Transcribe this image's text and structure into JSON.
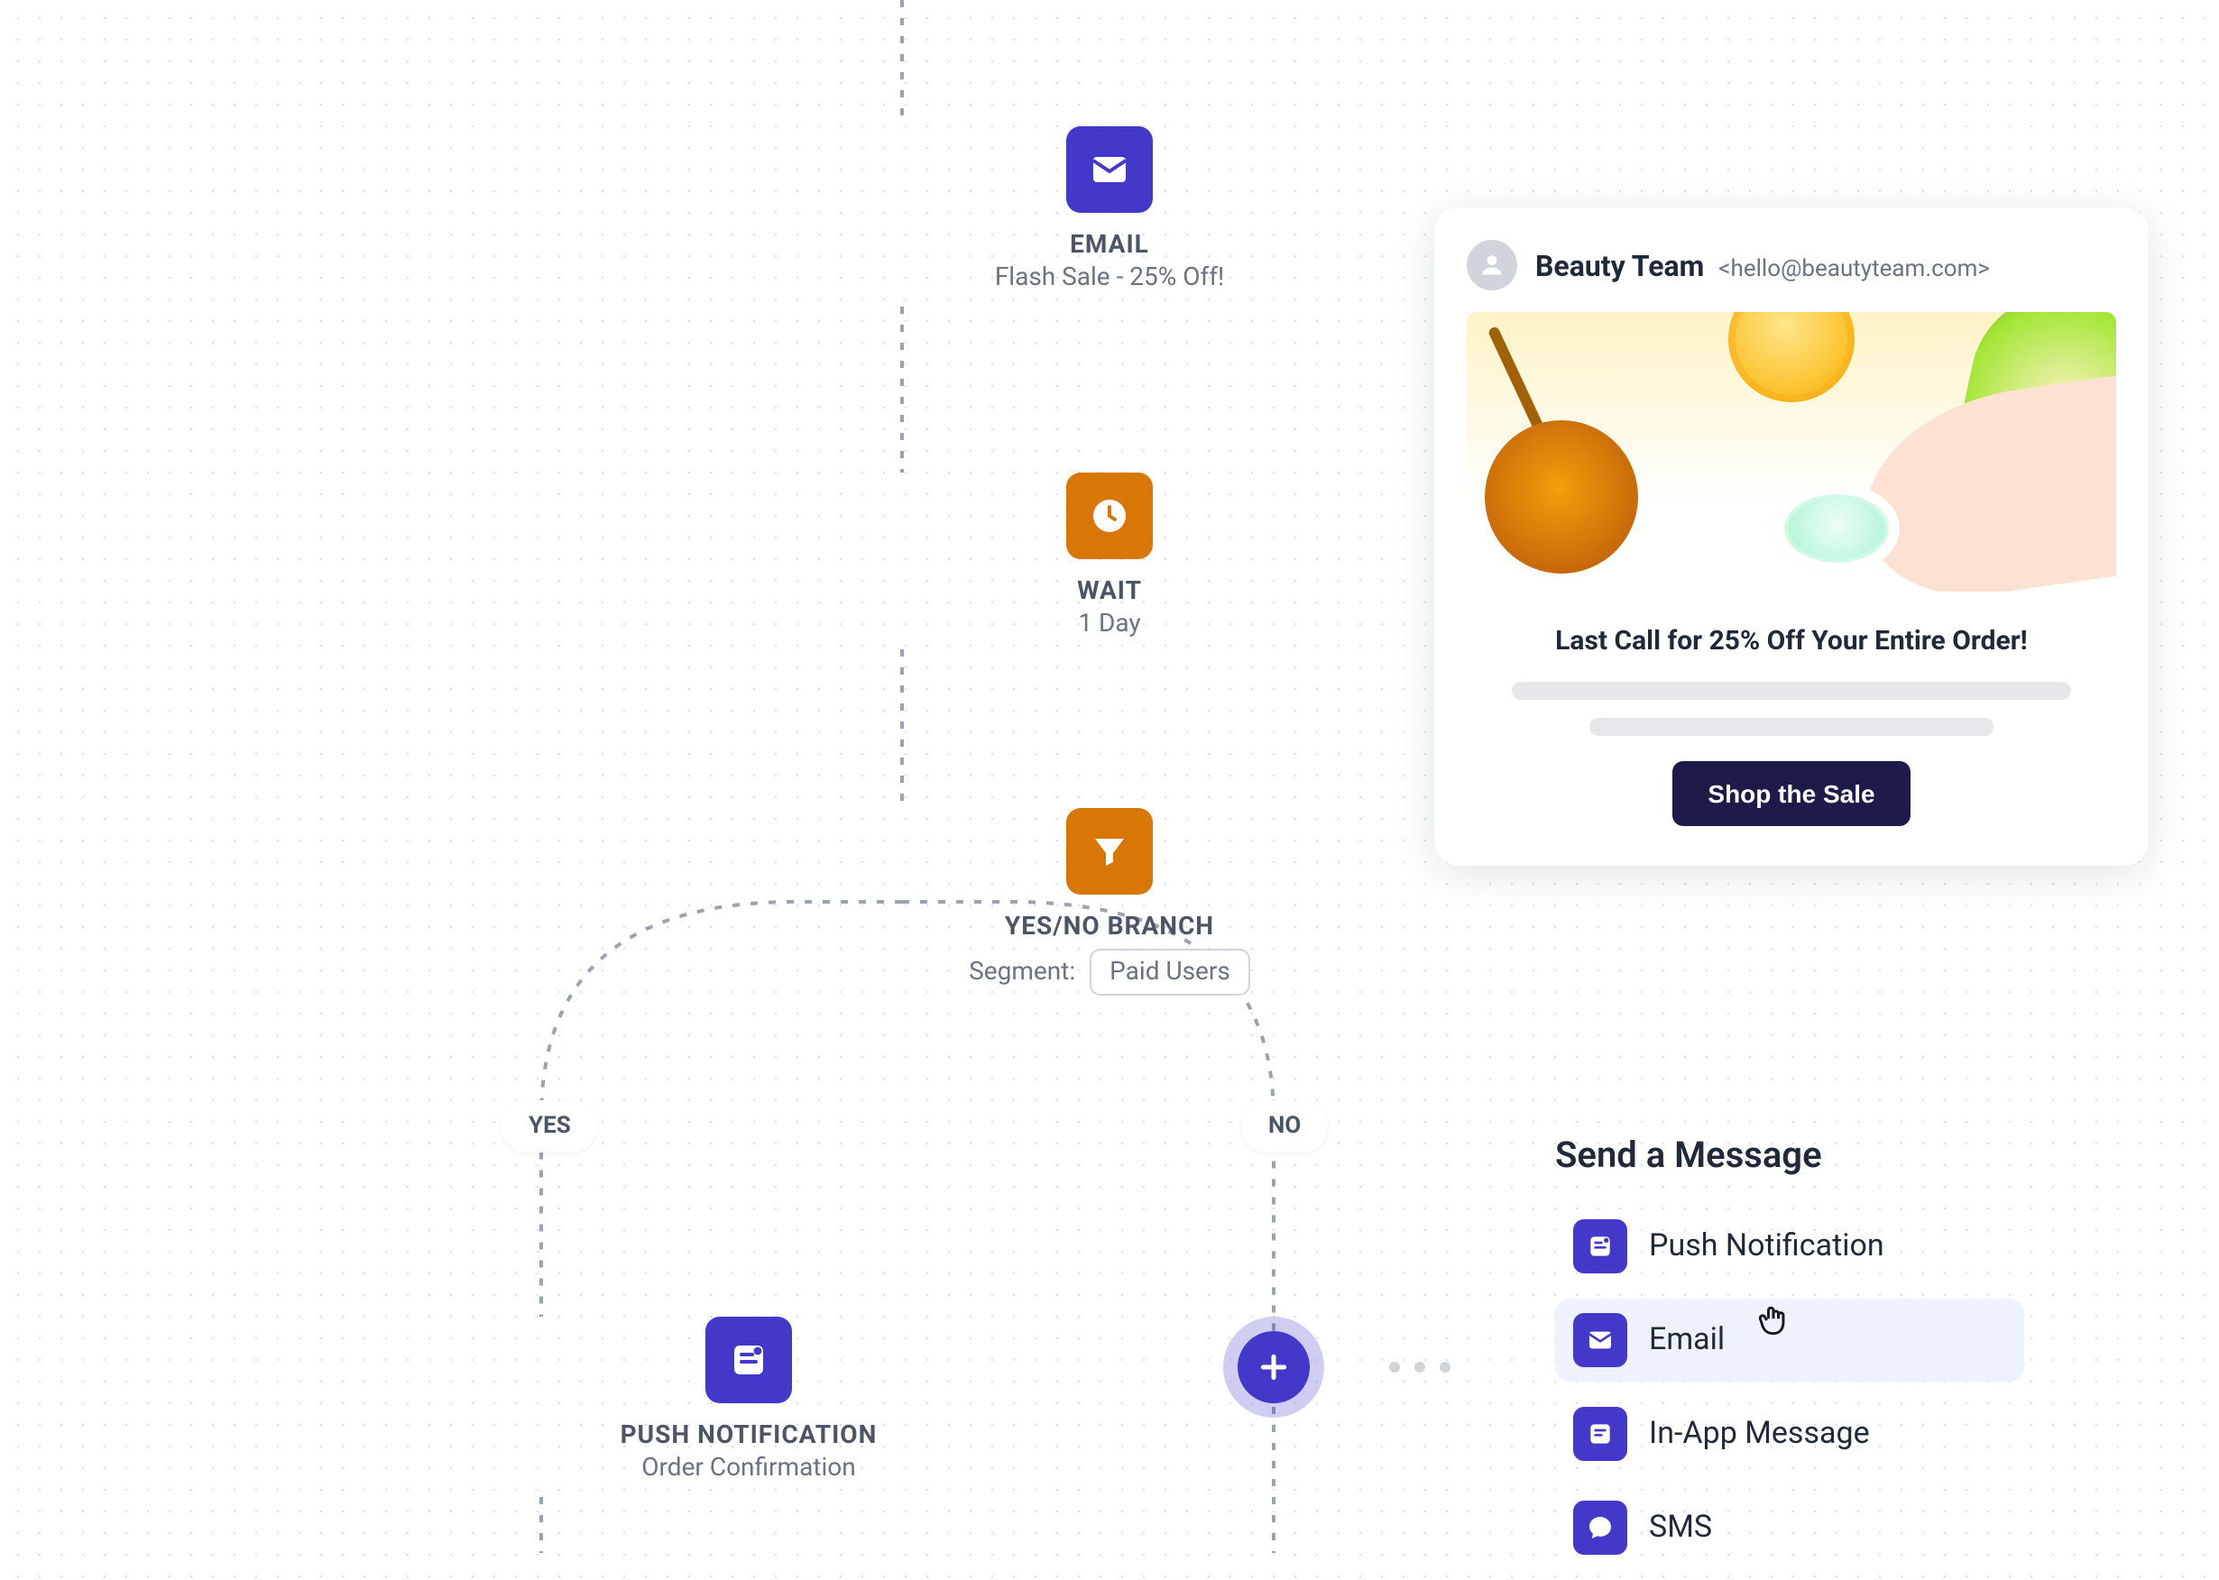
{
  "flow": {
    "email": {
      "title": "EMAIL",
      "subtitle": "Flash Sale - 25% Off!"
    },
    "wait": {
      "title": "WAIT",
      "subtitle": "1 Day"
    },
    "branch": {
      "title": "YES/NO BRANCH",
      "segment_label": "Segment:",
      "segment_value": "Paid Users"
    },
    "push": {
      "title": "PUSH NOTIFICATION",
      "subtitle": "Order Confirmation"
    },
    "badge_yes": "YES",
    "badge_no": "NO"
  },
  "preview": {
    "from_name": "Beauty Team",
    "from_addr": "<hello@beautyteam.com>",
    "headline": "Last Call for 25% Off Your Entire Order!",
    "cta": "Shop the Sale"
  },
  "menu": {
    "title": "Send a Message",
    "items": [
      {
        "icon": "push",
        "label": "Push Notification",
        "selected": false
      },
      {
        "icon": "email",
        "label": "Email",
        "selected": true
      },
      {
        "icon": "inapp",
        "label": "In-App Message",
        "selected": false
      },
      {
        "icon": "sms",
        "label": "SMS",
        "selected": false
      }
    ]
  },
  "colors": {
    "primary": "#4338CA",
    "amber": "#D97706",
    "cta_dark": "#1E1B4B"
  }
}
